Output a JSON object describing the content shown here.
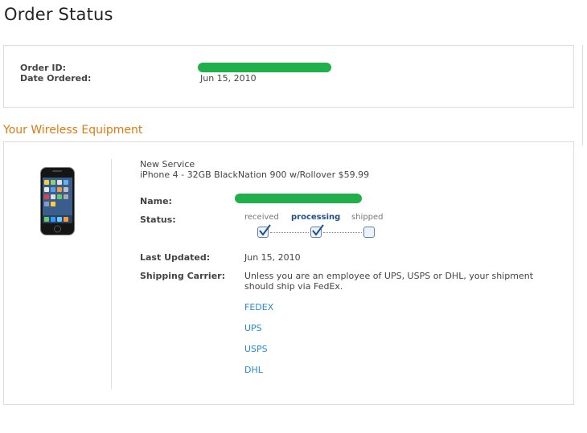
{
  "page": {
    "title": "Order Status"
  },
  "order": {
    "order_id_label": "Order ID:",
    "date_ordered_label": "Date Ordered:",
    "date_ordered_value": "Jun 15, 2010"
  },
  "section": {
    "title": "Your Wireless Equipment"
  },
  "equipment": {
    "service_type": "New Service",
    "product_desc": "iPhone 4 - 32GB BlackNation 900 w/Rollover $59.99",
    "name_label": "Name:",
    "status_label": "Status:",
    "status_steps": [
      "received",
      "processing",
      "shipped"
    ],
    "last_updated_label": "Last Updated:",
    "last_updated_value": "Jun 15, 2010",
    "shipping_carrier_label": "Shipping Carrier:",
    "shipping_note_line1": "Unless you are an employee of UPS, USPS or DHL, your shipment",
    "shipping_note_line2": "should ship via FedEx.",
    "carriers": [
      "FEDEX",
      "UPS",
      "USPS",
      "DHL"
    ]
  },
  "colors": {
    "accent_orange": "#e07a10",
    "link_blue": "#2a8ad2",
    "redaction_green": "#1fb04c"
  }
}
